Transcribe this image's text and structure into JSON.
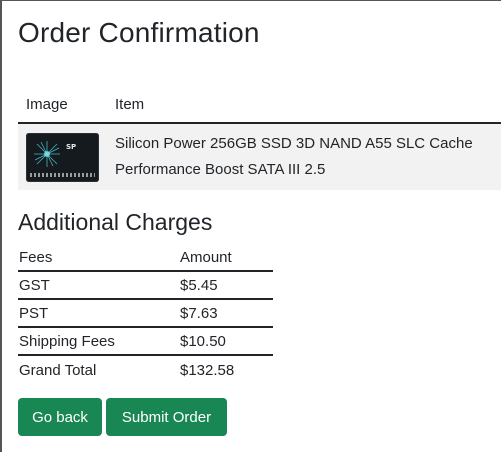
{
  "page": {
    "title": "Order Confirmation"
  },
  "items_table": {
    "headers": {
      "image": "Image",
      "item": "Item"
    },
    "rows": [
      {
        "image_icon": "ssd-product-image",
        "image_brand": "SP",
        "item": "Silicon Power 256GB SSD 3D NAND A55 SLC Cache Performance Boost SATA III 2.5"
      }
    ]
  },
  "charges": {
    "title": "Additional Charges",
    "headers": {
      "fees": "Fees",
      "amount": "Amount"
    },
    "rows": [
      {
        "label": "GST",
        "amount": "$5.45"
      },
      {
        "label": "PST",
        "amount": "$7.63"
      },
      {
        "label": "Shipping Fees",
        "amount": "$10.50"
      },
      {
        "label": "Grand Total",
        "amount": "$132.58"
      }
    ]
  },
  "actions": {
    "back_label": "Go back",
    "submit_label": "Submit Order"
  },
  "colors": {
    "button_bg": "#198754",
    "row_bg": "#f2f2f2",
    "text": "#212529"
  }
}
